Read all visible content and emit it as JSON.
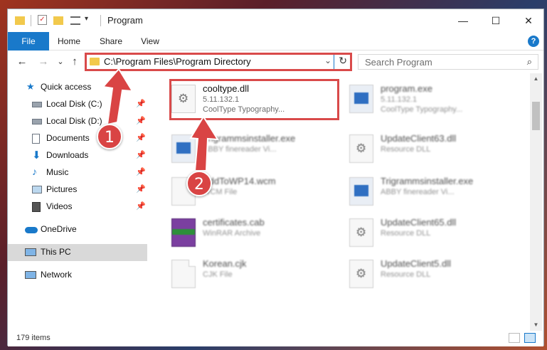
{
  "window": {
    "title": "Program",
    "controls": {
      "minimize": "—",
      "maximize": "☐",
      "close": "✕"
    }
  },
  "ribbon": {
    "tabs": [
      {
        "label": "File"
      },
      {
        "label": "Home"
      },
      {
        "label": "Share"
      },
      {
        "label": "View"
      }
    ],
    "help": "?"
  },
  "address": {
    "path": "C:\\Program Files\\Program Directory",
    "back": "←",
    "forward": "→",
    "recent": "⌄",
    "up": "↑",
    "dropdown": "⌄",
    "refresh": "↻"
  },
  "search": {
    "placeholder": "Search Program",
    "icon": "⌕"
  },
  "sidebar": {
    "items": [
      {
        "label": "Quick access",
        "icon": "star-icon"
      },
      {
        "label": "Local Disk (C:)",
        "icon": "drive-icon",
        "pinned": true
      },
      {
        "label": "Local Disk (D:)",
        "icon": "drive-icon",
        "pinned": true
      },
      {
        "label": "Documents",
        "icon": "document-icon",
        "pinned": true
      },
      {
        "label": "Downloads",
        "icon": "download-icon",
        "pinned": true
      },
      {
        "label": "Music",
        "icon": "music-icon",
        "pinned": true
      },
      {
        "label": "Pictures",
        "icon": "picture-icon",
        "pinned": true
      },
      {
        "label": "Videos",
        "icon": "video-icon",
        "pinned": true
      },
      {
        "label": "OneDrive",
        "icon": "cloud-icon"
      },
      {
        "label": "This PC",
        "icon": "computer-icon",
        "selected": true
      },
      {
        "label": "Network",
        "icon": "network-icon"
      }
    ]
  },
  "files": [
    {
      "name": "cooltype.dll",
      "version": "5.11.132.1",
      "desc": "CoolType Typography...",
      "type": "dll",
      "highlighted": true
    },
    {
      "name": "program.exe",
      "version": "5.11.132.1",
      "desc": "CoolType Typography...",
      "type": "exe"
    },
    {
      "name": "Trigrammsinstaller.exe",
      "version": "",
      "desc": "ABBY finereader Vi...",
      "type": "exe"
    },
    {
      "name": "UpdateClient63.dll",
      "version": "",
      "desc": "Resource DLL",
      "type": "dll"
    },
    {
      "name": "AddToWP14.wcm",
      "version": "",
      "desc": "WCM File",
      "type": "wcm"
    },
    {
      "name": "Trigrammsinstaller.exe",
      "version": "",
      "desc": "ABBY finereader Vi...",
      "type": "exe"
    },
    {
      "name": "certificates.cab",
      "version": "",
      "desc": "WinRAR Archive",
      "type": "cab"
    },
    {
      "name": "UpdateClient65.dll",
      "version": "",
      "desc": "Resource DLL",
      "type": "dll"
    },
    {
      "name": "Korean.cjk",
      "version": "",
      "desc": "CJK File",
      "type": "cjk"
    },
    {
      "name": "UpdateClient5.dll",
      "version": "",
      "desc": "Resource DLL",
      "type": "dll"
    }
  ],
  "status": {
    "count": "179 items"
  },
  "markers": [
    {
      "label": "1"
    },
    {
      "label": "2"
    }
  ],
  "colors": {
    "accent": "#1979ca",
    "highlight": "#d94a4a"
  }
}
